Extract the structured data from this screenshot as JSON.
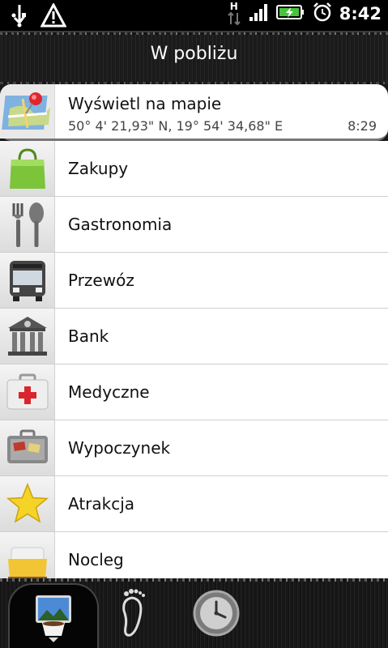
{
  "statusbar": {
    "time": "8:42",
    "network_label": "H",
    "icons": [
      "usb-icon",
      "warning-icon",
      "data-arrows-icon",
      "signal-icon",
      "battery-charging-icon",
      "alarm-icon"
    ]
  },
  "header": {
    "title": "W pobliżu"
  },
  "map_entry": {
    "title": "Wyświetl na mapie",
    "coordinates": "50° 4' 21,93\" N, 19° 54' 34,68\" E",
    "time": "8:29",
    "icon": "map-pin-icon"
  },
  "categories": [
    {
      "label": "Zakupy",
      "icon": "shopping-bag-icon"
    },
    {
      "label": "Gastronomia",
      "icon": "fork-spoon-icon"
    },
    {
      "label": "Przewóz",
      "icon": "bus-icon"
    },
    {
      "label": "Bank",
      "icon": "bank-icon"
    },
    {
      "label": "Medyczne",
      "icon": "first-aid-kit-icon"
    },
    {
      "label": "Wypoczynek",
      "icon": "suitcase-icon"
    },
    {
      "label": "Atrakcja",
      "icon": "star-icon"
    },
    {
      "label": "Nocleg",
      "icon": "bed-icon"
    }
  ],
  "bottom_tabs": [
    {
      "name": "places-tab",
      "icon": "picture-mug-icon",
      "active": true
    },
    {
      "name": "footprints-tab",
      "icon": "footprint-icon",
      "active": false
    },
    {
      "name": "history-tab",
      "icon": "clock-icon",
      "active": false
    }
  ]
}
